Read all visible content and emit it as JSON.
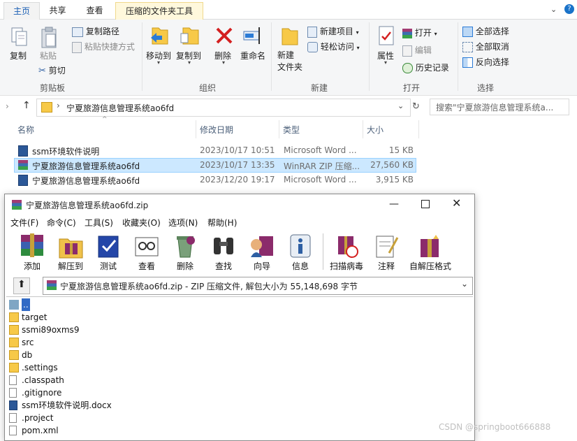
{
  "explorer": {
    "tabs": [
      {
        "label": "主页"
      },
      {
        "label": "共享"
      },
      {
        "label": "查看"
      },
      {
        "label": "压缩的文件夹工具"
      }
    ],
    "ribbon": {
      "clipboard": {
        "copy": "复制",
        "paste": "粘贴",
        "copy_path": "复制路径",
        "paste_shortcut": "粘贴快捷方式",
        "cut": "剪切",
        "group": "剪贴板"
      },
      "organize": {
        "move_to": "移动到",
        "copy_to": "复制到",
        "delete": "删除",
        "rename": "重命名",
        "group": "组织"
      },
      "new": {
        "new_folder": "新建\n文件夹",
        "new_item": "新建项目",
        "easy_access": "轻松访问",
        "group": "新建"
      },
      "open": {
        "properties": "属性",
        "open": "打开",
        "edit": "编辑",
        "history": "历史记录",
        "group": "打开"
      },
      "select": {
        "select_all": "全部选择",
        "select_none": "全部取消",
        "invert": "反向选择",
        "group": "选择"
      }
    },
    "address": "宁夏旅游信息管理系统ao6fd",
    "search_placeholder": "搜索\"宁夏旅游信息管理系统a...",
    "columns": {
      "name": "名称",
      "date": "修改日期",
      "type": "类型",
      "size": "大小"
    },
    "files": [
      {
        "name": "ssm环境软件说明",
        "date": "2023/10/17 10:51",
        "type": "Microsoft Word ...",
        "size": "15 KB",
        "icon": "word-icon"
      },
      {
        "name": "宁夏旅游信息管理系统ao6fd",
        "date": "2023/10/17 13:35",
        "type": "WinRAR ZIP 压缩...",
        "size": "27,560 KB",
        "icon": "winrar-icon"
      },
      {
        "name": "宁夏旅游信息管理系统ao6fd",
        "date": "2023/12/20 19:17",
        "type": "Microsoft Word ...",
        "size": "3,915 KB",
        "icon": "word-icon"
      }
    ]
  },
  "winrar": {
    "title": "宁夏旅游信息管理系统ao6fd.zip",
    "menus": [
      "文件(F)",
      "命令(C)",
      "工具(S)",
      "收藏夹(O)",
      "选项(N)",
      "帮助(H)"
    ],
    "toolbar": [
      {
        "label": "添加",
        "icon": "add-archive-icon"
      },
      {
        "label": "解压到",
        "icon": "extract-icon"
      },
      {
        "label": "测试",
        "icon": "test-icon"
      },
      {
        "label": "查看",
        "icon": "view-icon"
      },
      {
        "label": "删除",
        "icon": "delete-icon"
      },
      {
        "label": "查找",
        "icon": "find-icon"
      },
      {
        "label": "向导",
        "icon": "wizard-icon"
      },
      {
        "label": "信息",
        "icon": "info-icon"
      },
      {
        "label": "扫描病毒",
        "icon": "scan-virus-icon"
      },
      {
        "label": "注释",
        "icon": "comment-icon"
      },
      {
        "label": "自解压格式",
        "icon": "sfx-icon"
      }
    ],
    "path": "宁夏旅游信息管理系统ao6fd.zip - ZIP 压缩文件, 解包大小为 55,148,698 字节",
    "entries": [
      {
        "name": "..",
        "icon": "up-folder-icon"
      },
      {
        "name": "target",
        "icon": "folder-icon"
      },
      {
        "name": "ssmi89oxms9",
        "icon": "folder-icon"
      },
      {
        "name": "src",
        "icon": "folder-icon"
      },
      {
        "name": "db",
        "icon": "folder-icon"
      },
      {
        "name": ".settings",
        "icon": "folder-icon"
      },
      {
        "name": ".classpath",
        "icon": "file-icon"
      },
      {
        "name": ".gitignore",
        "icon": "file-icon"
      },
      {
        "name": "ssm环境软件说明.docx",
        "icon": "word-icon"
      },
      {
        "name": ".project",
        "icon": "file-icon"
      },
      {
        "name": "pom.xml",
        "icon": "file-icon"
      }
    ]
  },
  "watermark": "CSDN @springboot666888"
}
